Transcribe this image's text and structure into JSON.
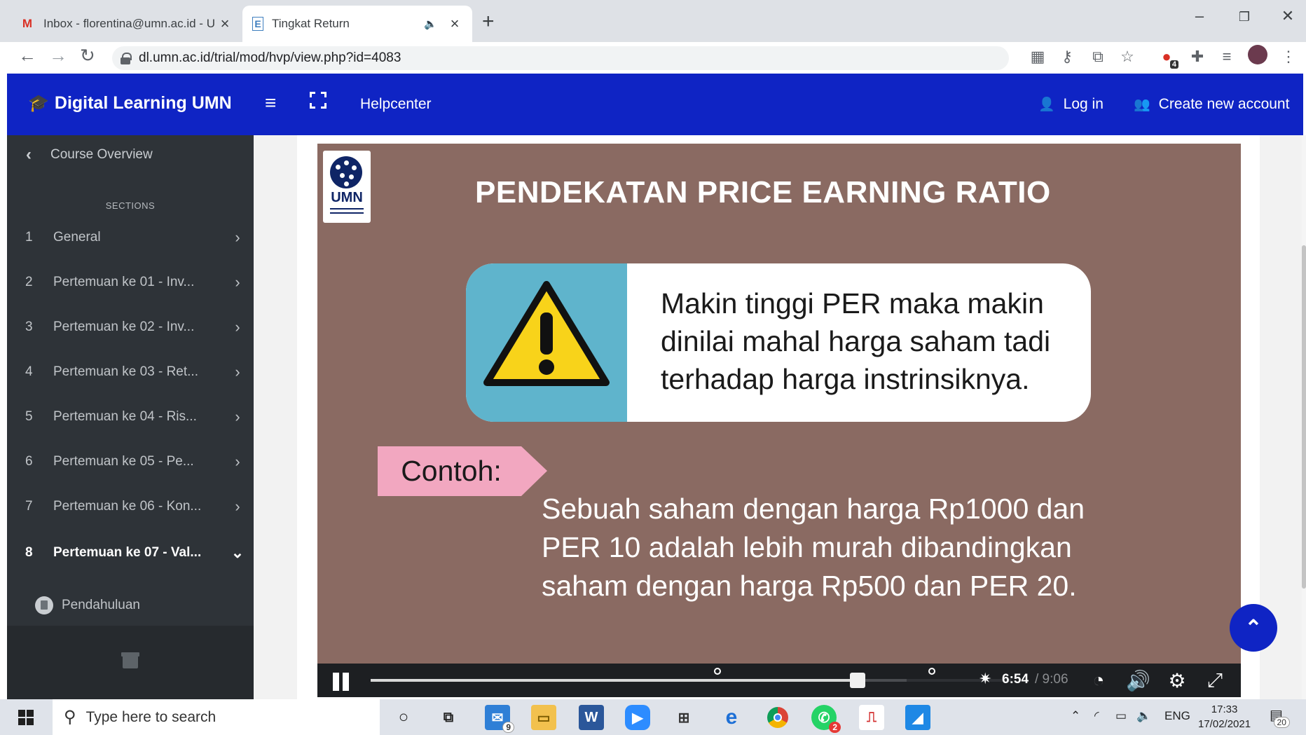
{
  "browser": {
    "tabs": [
      {
        "favicon": "gmail-icon",
        "title": "Inbox - florentina@umn.ac.id - U",
        "active": false
      },
      {
        "favicon": "E",
        "title": "Tingkat Return",
        "active": true,
        "muted_icon": "speaker-icon"
      }
    ],
    "url": "dl.umn.ac.id/trial/mod/hvp/view.php?id=4083",
    "extension_badge": "4"
  },
  "header": {
    "brand": "Digital Learning UMN",
    "helpcenter": "Helpcenter",
    "login": "Log in",
    "create_account": "Create new account",
    "bg_color": "#0f24c4"
  },
  "sidebar": {
    "course_overview": "Course Overview",
    "sections_label": "SECTIONS",
    "items": [
      {
        "num": "1",
        "label": "General"
      },
      {
        "num": "2",
        "label": "Pertemuan ke 01 - Inv..."
      },
      {
        "num": "3",
        "label": "Pertemuan ke 02 - Inv..."
      },
      {
        "num": "4",
        "label": "Pertemuan ke 03 - Ret..."
      },
      {
        "num": "5",
        "label": "Pertemuan ke 04 - Ris..."
      },
      {
        "num": "6",
        "label": "Pertemuan ke 05 - Pe..."
      },
      {
        "num": "7",
        "label": "Pertemuan ke 06 - Kon..."
      },
      {
        "num": "8",
        "label": "Pertemuan ke 07 - Val...",
        "active": true
      }
    ],
    "subitem": "Pendahuluan"
  },
  "slide": {
    "logo_text": "UMN",
    "title": "PENDEKATAN PRICE EARNING RATIO",
    "warning_lines": [
      "Makin tinggi PER maka makin",
      "dinilai mahal harga saham tadi",
      "terhadap harga instrinsiknya."
    ],
    "contoh": "Contoh:",
    "example_lines": [
      "Sebuah saham dengan harga Rp1000 dan",
      "PER 10 adalah lebih murah dibandingkan",
      "saham dengan harga Rp500 dan PER 20."
    ],
    "bg_color": "#8a6a62",
    "accent_blue": "#5fb4cc",
    "accent_pink": "#f2a7c0"
  },
  "player": {
    "current_time": "6:54",
    "duration": "/ 9:06",
    "progress": 0.76
  },
  "taskbar": {
    "search_placeholder": "Type here to search",
    "mail_badge": "9",
    "whatsapp_badge": "2",
    "language": "ENG",
    "time": "17:33",
    "date": "17/02/2021",
    "notification_count": "20"
  }
}
